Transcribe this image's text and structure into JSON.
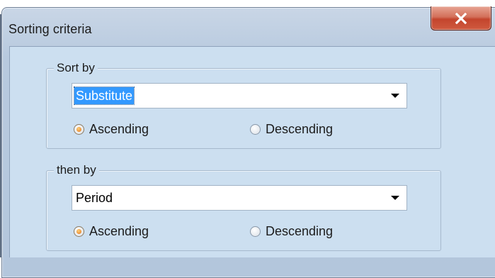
{
  "window": {
    "title": "Sorting criteria",
    "close_icon": "close-x-icon"
  },
  "sort_by": {
    "legend": "Sort by",
    "selected_value": "Substitute",
    "ascending_label": "Ascending",
    "descending_label": "Descending",
    "order": "Ascending"
  },
  "then_by": {
    "legend": "then by",
    "selected_value": "Period",
    "ascending_label": "Ascending",
    "descending_label": "Descending",
    "order": "Ascending"
  },
  "colors": {
    "close_button": "#c4452d",
    "selection_highlight": "#3399ff",
    "client_background": "#ccdff0"
  }
}
